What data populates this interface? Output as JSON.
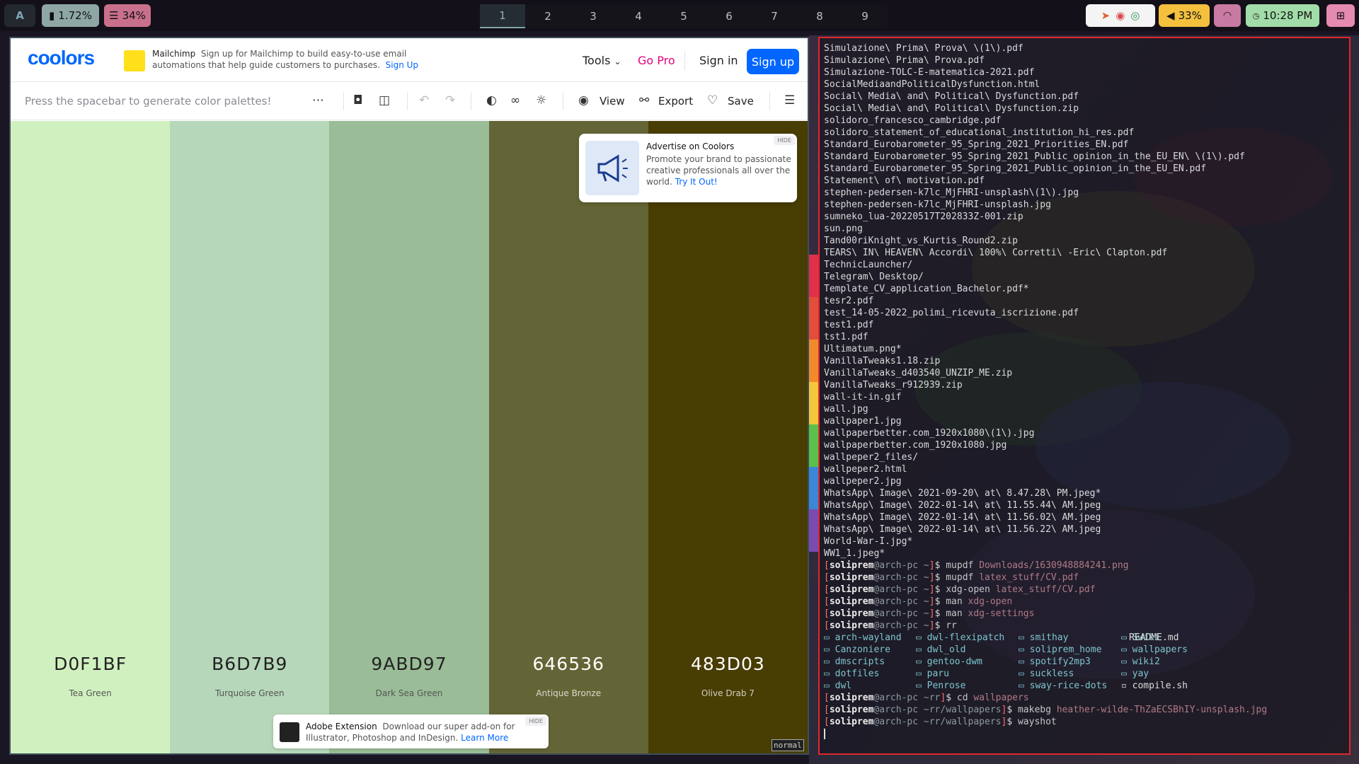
{
  "topbar": {
    "app_label": "A",
    "cpu": "1.72%",
    "mem": "34%",
    "workspaces": [
      "1",
      "2",
      "3",
      "4",
      "5",
      "6",
      "7",
      "8",
      "9"
    ],
    "active_workspace": "1",
    "volume": "33%",
    "clock": "10:28 PM",
    "tray_icons": [
      "telegram-icon",
      "discord-icon",
      "whatsapp-icon"
    ],
    "colors": {
      "cpu_bg": "#8ea7a5",
      "mem_bg": "#c9708d",
      "vol_bg": "#f4c03e",
      "clock_bg": "#a2dca8",
      "wifi_bg": "#c87aa3"
    }
  },
  "browser": {
    "logo": "coolors",
    "ad_top": {
      "brand": "Mailchimp",
      "text": "Sign up for Mailchimp to build easy-to-use email automations that help guide customers to purchases.",
      "link": "Sign Up"
    },
    "nav": {
      "tools": "Tools",
      "gopro": "Go Pro",
      "signin": "Sign in",
      "signup": "Sign up"
    },
    "toolbar": {
      "hint": "Press the spacebar to generate color palettes!",
      "view": "View",
      "export": "Export",
      "save": "Save"
    },
    "palette": [
      {
        "hex": "D0F1BF",
        "name": "Tea Green",
        "color": "#d0f1bf",
        "text": "#222"
      },
      {
        "hex": "B6D7B9",
        "name": "Turquoise Green",
        "color": "#b6d7b9",
        "text": "#222"
      },
      {
        "hex": "9ABD97",
        "name": "Dark Sea Green",
        "color": "#9abd97",
        "text": "#222"
      },
      {
        "hex": "646536",
        "name": "Antique Bronze",
        "color": "#646536",
        "text": "#fff"
      },
      {
        "hex": "483D03",
        "name": "Olive Drab 7",
        "color": "#483d03",
        "text": "#fff"
      }
    ],
    "ad_side": {
      "title": "Advertise on Coolors",
      "text": "Promote your brand to passionate creative professionals all over the world.",
      "link": "Try It Out!",
      "hide": "HIDE"
    },
    "ad_bottom": {
      "title": "Adobe Extension",
      "text": "Download our super add-on for Illustrator, Photoshop and InDesign.",
      "link": "Learn More",
      "hide": "HIDE"
    },
    "mode": "normal"
  },
  "terminal": {
    "files": [
      "Simulazione\\ Prima\\ Prova\\ \\(1\\).pdf",
      "Simulazione\\ Prima\\ Prova.pdf",
      "Simulazione-TOLC-E-matematica-2021.pdf",
      "SocialMediaandPoliticalDysfunction.html",
      "Social\\ Media\\ and\\ Political\\ Dysfunction.pdf",
      "Social\\ Media\\ and\\ Political\\ Dysfunction.zip",
      "solidoro_francesco_cambridge.pdf",
      "solidoro_statement_of_educational_institution_hi_res.pdf",
      "Standard_Eurobarometer_95_Spring_2021_Priorities_EN.pdf",
      "Standard_Eurobarometer_95_Spring_2021_Public_opinion_in_the_EU_EN\\ \\(1\\).pdf",
      "Standard_Eurobarometer_95_Spring_2021_Public_opinion_in_the_EU_EN.pdf",
      "Statement\\ of\\ motivation.pdf",
      "stephen-pedersen-k7lc_MjFHRI-unsplash\\(1\\).jpg",
      "stephen-pedersen-k7lc_MjFHRI-unsplash.jpg",
      "sumneko_lua-20220517T202833Z-001.zip",
      "sun.png",
      "Tand00riKnight_vs_Kurtis_Round2.zip",
      "TEARS\\ IN\\ HEAVEN\\ Accordi\\ 100%\\ Corretti\\ -Eric\\ Clapton.pdf",
      "TechnicLauncher/",
      "Telegram\\ Desktop/",
      "Template_CV_application_Bachelor.pdf*",
      "tesr2.pdf",
      "test_14-05-2022_polimi_ricevuta_iscrizione.pdf",
      "test1.pdf",
      "tst1.pdf",
      "Ultimatum.png*",
      "VanillaTweaks1.18.zip",
      "VanillaTweaks_d403540_UNZIP_ME.zip",
      "VanillaTweaks_r912939.zip",
      "wall-it-in.gif",
      "wall.jpg",
      "wallpaper1.jpg",
      "wallpaperbetter.com_1920x1080\\(1\\).jpg",
      "wallpaperbetter.com_1920x1080.jpg",
      "wallpeper2_files/",
      "wallpeper2.html",
      "wallpeper2.jpg",
      "WhatsApp\\ Image\\ 2021-09-20\\ at\\ 8.47.28\\ PM.jpeg*",
      "WhatsApp\\ Image\\ 2022-01-14\\ at\\ 11.55.44\\ AM.jpeg",
      "WhatsApp\\ Image\\ 2022-01-14\\ at\\ 11.56.02\\ AM.jpeg",
      "WhatsApp\\ Image\\ 2022-01-14\\ at\\ 11.56.22\\ AM.jpeg",
      "World-War-I.jpg*",
      "WW1_1.jpeg*"
    ],
    "prompts": [
      {
        "user": "soliprem",
        "host": "arch-pc",
        "dir": "~",
        "cmd": "mupdf",
        "arg": "Downloads/1630948884241.png"
      },
      {
        "user": "soliprem",
        "host": "arch-pc",
        "dir": "~",
        "cmd": "mupdf",
        "arg": "latex_stuff/CV.pdf"
      },
      {
        "user": "soliprem",
        "host": "arch-pc",
        "dir": "~",
        "cmd": "xdg-open",
        "arg": "latex_stuff/CV.pdf"
      },
      {
        "user": "soliprem",
        "host": "arch-pc",
        "dir": "~",
        "cmd": "man",
        "arg": "xdg-open"
      },
      {
        "user": "soliprem",
        "host": "arch-pc",
        "dir": "~",
        "cmd": "man",
        "arg": "xdg-settings"
      },
      {
        "user": "soliprem",
        "host": "arch-pc",
        "dir": "~",
        "cmd": "rr",
        "arg": ""
      }
    ],
    "listing": [
      "arch-wayland",
      "dwl-flexipatch",
      "smithay",
      "Swiki",
      "Canzoniere",
      "dwl_old",
      "soliprem_home",
      "wallpapers",
      "dmscripts",
      "gentoo-dwm",
      "spotify2mp3",
      "wiki2",
      "dotfiles",
      "paru",
      "suckless",
      "yay",
      "dwl",
      "Penrose",
      "sway-rice-dots",
      "compile.sh"
    ],
    "readme": "README.md",
    "prompts2": [
      {
        "user": "soliprem",
        "host": "arch-pc",
        "dir": "~rr",
        "cmd": "cd",
        "arg": "wallpapers"
      },
      {
        "user": "soliprem",
        "host": "arch-pc",
        "dir": "~rr/wallpapers",
        "cmd": "makebg",
        "arg": "heather-wilde-ThZaECSBhIY-unsplash.jpg"
      },
      {
        "user": "soliprem",
        "host": "arch-pc",
        "dir": "~rr/wallpapers",
        "cmd": "wayshot",
        "arg": ""
      }
    ]
  }
}
